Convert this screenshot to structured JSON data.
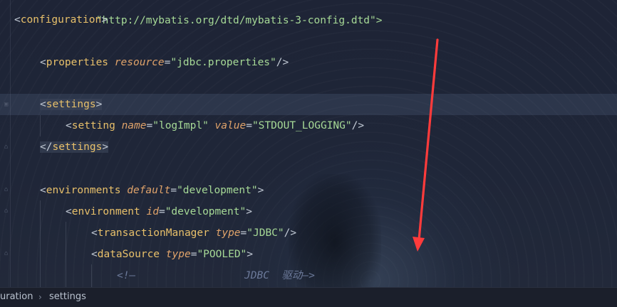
{
  "editor": {
    "line_top_partial": "\"http://mybatis.org/dtd/mybatis-3-config.dtd\">",
    "configuration_open": "configuration",
    "properties": {
      "tag": "properties",
      "attr": "resource",
      "value": "\"jdbc.properties\""
    },
    "settings_open": "settings",
    "setting": {
      "tag": "setting",
      "attr1": "name",
      "val1": "\"logImpl\"",
      "attr2": "value",
      "val2": "\"STDOUT_LOGGING\""
    },
    "settings_close": "settings",
    "environments": {
      "tag": "environments",
      "attr": "default",
      "value": "\"development\""
    },
    "environment": {
      "tag": "environment",
      "attr": "id",
      "value": "\"development\""
    },
    "transaction_manager": {
      "tag": "transactionManager",
      "attr": "type",
      "value": "\"JDBC\""
    },
    "data_source": {
      "tag": "dataSource",
      "attr": "type",
      "value": "\"POOLED\""
    },
    "comment_start": "<!—",
    "comment_text": "JDBC  驱动—>"
  },
  "breadcrumb": {
    "items": [
      "uration",
      "settings"
    ],
    "separator": "›"
  },
  "colors": {
    "tag": "#e8c06a",
    "attribute": "#e0a36a",
    "string": "#a6d996",
    "comment": "#6c7a9a",
    "annotation_arrow": "#ff3b3b"
  }
}
